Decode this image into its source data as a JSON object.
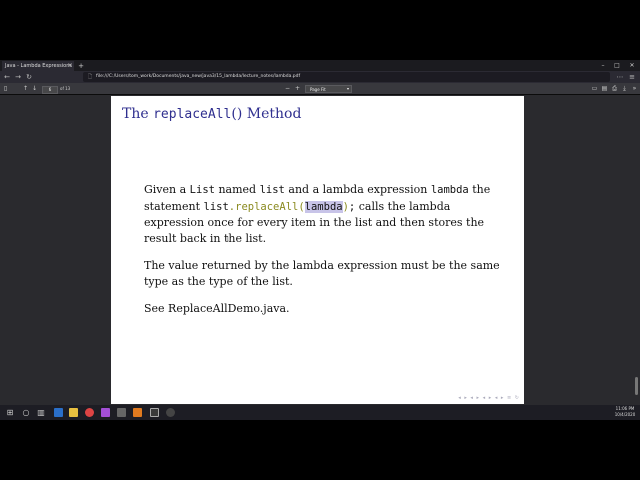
{
  "browser": {
    "tab_title": "Java - Lambda Expressions and Fu...",
    "tab_close": "×",
    "new_tab": "+",
    "window_controls": {
      "minimize": "–",
      "maximize": "□",
      "close": "✕"
    },
    "nav": {
      "back": "←",
      "forward": "→",
      "reload": "↻"
    },
    "url": "file:///C:/Users/tom_work/Documents/java_new/java3/15_lambda/lecture_notes/lambda.pdf"
  },
  "pdf_toolbar": {
    "page_number": "6",
    "page_count": "of 13",
    "zoom": "Page Fit"
  },
  "slide": {
    "title_pre": "The ",
    "title_code": "replaceAll",
    "title_post": "() Method",
    "para1": {
      "t1": "Given a ",
      "c1": "List",
      "t2": " named ",
      "c2": "list",
      "t3": " and a lambda expression ",
      "c3": "lambda",
      "t4": " the statement ",
      "c4": "list",
      "c5": ".replaceAll(",
      "c6": "lambda",
      "c7": ")",
      "c8": ";",
      "t5": " calls the lambda expression once for every item in the list and then stores the result back in the list."
    },
    "para2": "The value returned by the lambda expression must be the same type as the type of the list.",
    "para3": "See ReplaceAllDemo.java."
  },
  "taskbar": {
    "time": "11:06 PM",
    "date": "10/4/2020"
  },
  "colors": {
    "slide_title": "#2f2f8f",
    "highlight": "#c8c4e8",
    "toolbar": "#38383d"
  }
}
